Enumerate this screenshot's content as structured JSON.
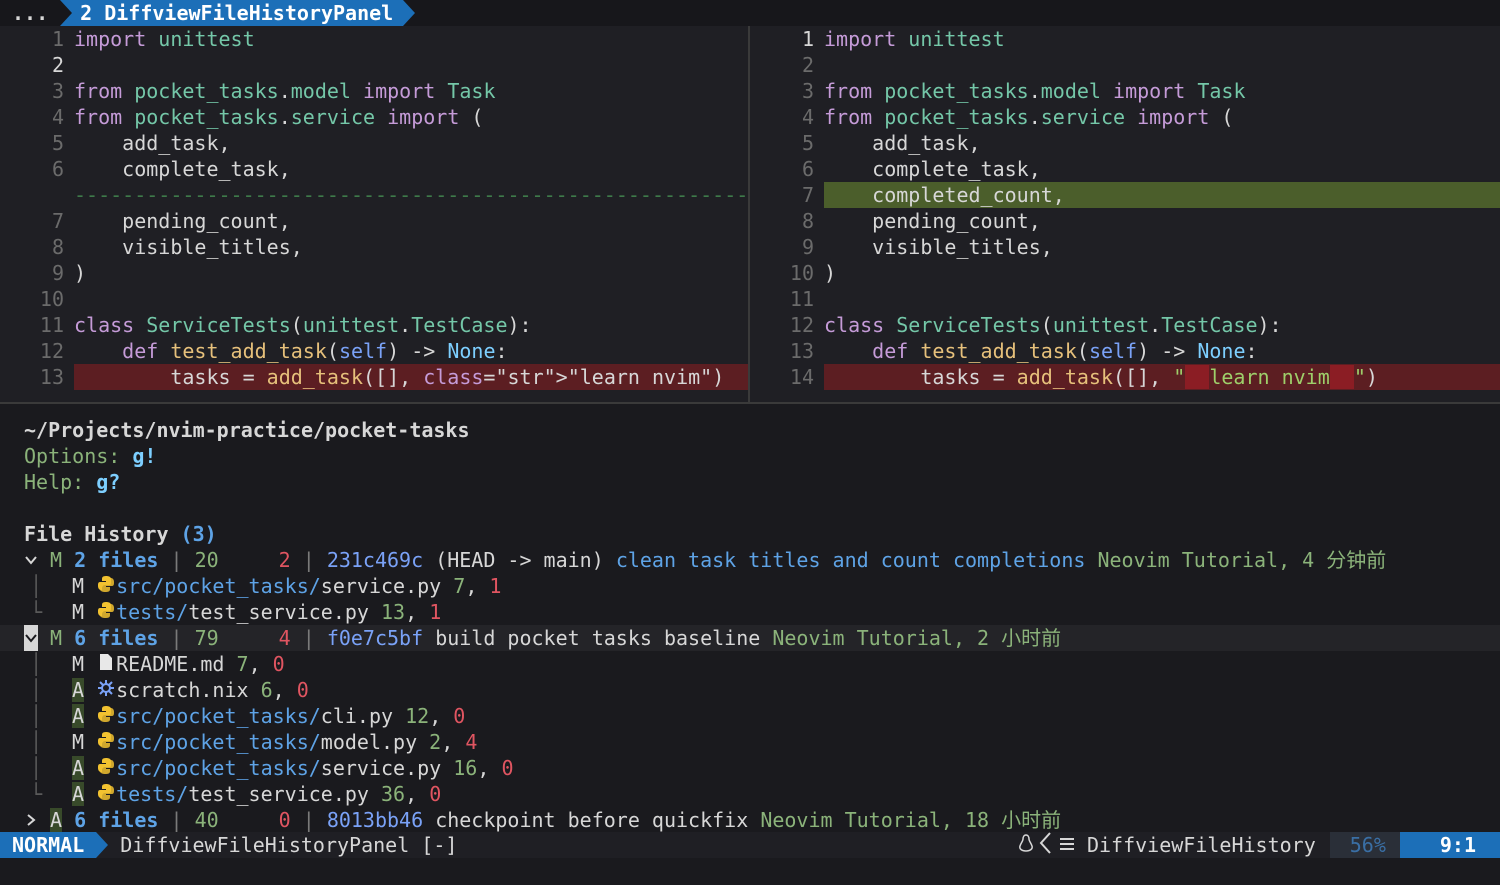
{
  "tabline": {
    "ellipsis": "...",
    "active_tab": "2 DiffviewFileHistoryPanel"
  },
  "left_pane": {
    "lines": [
      {
        "n": "1",
        "code": "import unittest"
      },
      {
        "n": "2",
        "code": ""
      },
      {
        "n": "3",
        "code": "from pocket_tasks.model import Task"
      },
      {
        "n": "4",
        "code": "from pocket_tasks.service import ("
      },
      {
        "n": "5",
        "code": "    add_task,"
      },
      {
        "n": "6",
        "code": "    complete_task,"
      },
      {
        "n": "",
        "code": "------------------------------------------------------------"
      },
      {
        "n": "7",
        "code": "    pending_count,"
      },
      {
        "n": "8",
        "code": "    visible_titles,"
      },
      {
        "n": "9",
        "code": ")"
      },
      {
        "n": "10",
        "code": ""
      },
      {
        "n": "11",
        "code": "class ServiceTests(unittest.TestCase):"
      },
      {
        "n": "12",
        "code": "    def test_add_task(self) -> None:"
      },
      {
        "n": "13",
        "code": "        tasks = add_task([], \"learn nvim\")"
      }
    ]
  },
  "right_pane": {
    "lines": [
      {
        "n": "1",
        "code": "import unittest"
      },
      {
        "n": "2",
        "code": ""
      },
      {
        "n": "3",
        "code": "from pocket_tasks.model import Task"
      },
      {
        "n": "4",
        "code": "from pocket_tasks.service import ("
      },
      {
        "n": "5",
        "code": "    add_task,"
      },
      {
        "n": "6",
        "code": "    complete_task,"
      },
      {
        "n": "7",
        "code": "    completed_count,"
      },
      {
        "n": "8",
        "code": "    pending_count,"
      },
      {
        "n": "9",
        "code": "    visible_titles,"
      },
      {
        "n": "10",
        "code": ")"
      },
      {
        "n": "11",
        "code": ""
      },
      {
        "n": "12",
        "code": "class ServiceTests(unittest.TestCase):"
      },
      {
        "n": "13",
        "code": "    def test_add_task(self) -> None:"
      },
      {
        "n": "14",
        "code": "        tasks = add_task([], \"  learn nvim  \")"
      }
    ]
  },
  "panel": {
    "path": "~/Projects/nvim-practice/pocket-tasks",
    "options_label": "Options:",
    "options_key": "g!",
    "help_label": "Help:",
    "help_key": "g?",
    "history_title": "File History",
    "history_count": "(3)",
    "commits": [
      {
        "fold": "v",
        "status": "M",
        "files": "2 files",
        "add": "20",
        "del": "2",
        "hash": "231c469c",
        "ref": "(HEAD -> main)",
        "subject": "clean task titles and count completions",
        "author": "Neovim Tutorial,",
        "age": "4 分钟前",
        "entries": [
          {
            "status": "M",
            "icon": "py",
            "dir": "src/pocket_tasks/",
            "file": "service.py",
            "add": "7",
            "del": "1"
          },
          {
            "status": "M",
            "icon": "py",
            "dir": "tests/",
            "file": "test_service.py",
            "add": "13",
            "del": "1"
          }
        ]
      },
      {
        "fold": "v",
        "status": "M",
        "files": "6 files",
        "add": "79",
        "del": "4",
        "hash": "f0e7c5bf",
        "ref": "",
        "subject": "build pocket tasks baseline",
        "author": "Neovim Tutorial,",
        "age": "2 小时前",
        "entries": [
          {
            "status": "M",
            "icon": "md",
            "dir": "",
            "file": "README.md",
            "add": "7",
            "del": "0"
          },
          {
            "status": "A",
            "icon": "nix",
            "dir": "",
            "file": "scratch.nix",
            "add": "6",
            "del": "0"
          },
          {
            "status": "A",
            "icon": "py",
            "dir": "src/pocket_tasks/",
            "file": "cli.py",
            "add": "12",
            "del": "0"
          },
          {
            "status": "M",
            "icon": "py",
            "dir": "src/pocket_tasks/",
            "file": "model.py",
            "add": "2",
            "del": "4"
          },
          {
            "status": "A",
            "icon": "py",
            "dir": "src/pocket_tasks/",
            "file": "service.py",
            "add": "16",
            "del": "0"
          },
          {
            "status": "A",
            "icon": "py",
            "dir": "tests/",
            "file": "test_service.py",
            "add": "36",
            "del": "0"
          }
        ]
      },
      {
        "fold": ">",
        "status": "A",
        "files": "6 files",
        "add": "40",
        "del": "0",
        "hash": "8013bb46",
        "ref": "",
        "subject": "checkpoint before quickfix",
        "author": "Neovim Tutorial,",
        "age": "18 小时前",
        "entries": []
      }
    ]
  },
  "statusbar": {
    "mode": "NORMAL",
    "filename": "DiffviewFileHistoryPanel [-]",
    "filetype": "DiffviewFileHistory",
    "percent": "56%",
    "position": "9:1"
  },
  "icons": {
    "python": "python-icon",
    "nix": "nix-icon",
    "markdown": "file-icon",
    "linux": "linux-icon"
  }
}
